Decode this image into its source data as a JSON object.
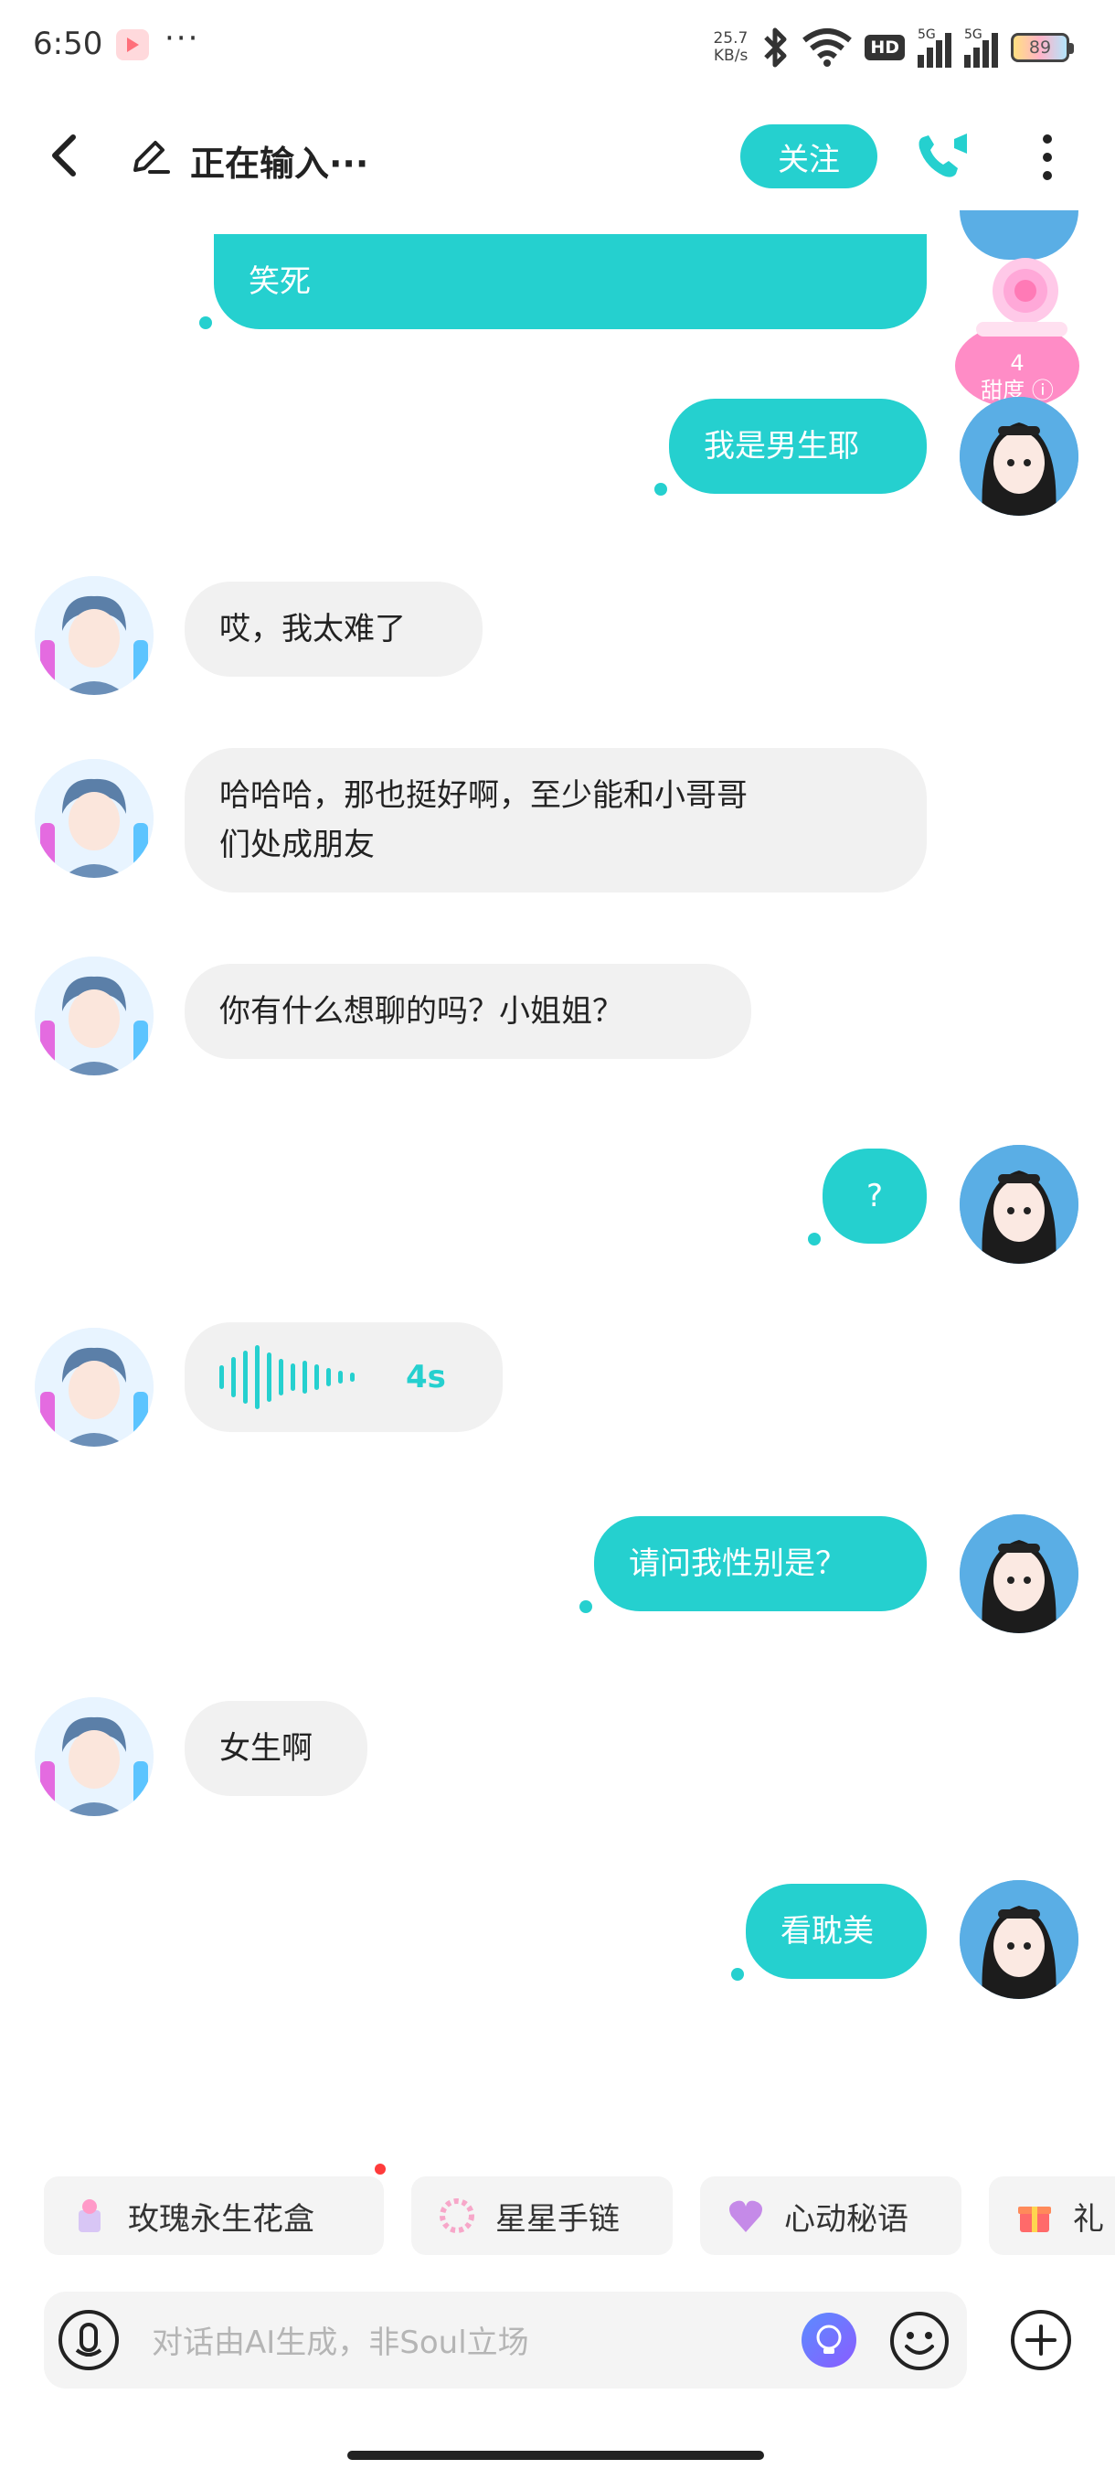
{
  "status_bar": {
    "time": "6:50",
    "dots": "···",
    "net_speed_value": "25.7",
    "net_speed_unit": "KB/s",
    "hd_label": "HD",
    "signal_label_1": "5G",
    "signal_label_2": "5G",
    "battery": "89"
  },
  "header": {
    "title": "正在输入···",
    "follow_label": "关注"
  },
  "sweetness": {
    "count": "4",
    "label": "甜度"
  },
  "messages": [
    {
      "side": "me",
      "text": "笑死"
    },
    {
      "side": "me",
      "text": "我是男生耶"
    },
    {
      "side": "them",
      "text": "哎，我太难了"
    },
    {
      "side": "them",
      "text": "哈哈哈，那也挺好啊，至少能和小哥哥\n们处成朋友"
    },
    {
      "side": "them",
      "text": "你有什么想聊的吗？小姐姐？"
    },
    {
      "side": "me",
      "text": "?"
    },
    {
      "side": "them",
      "type": "voice",
      "duration": "4s"
    },
    {
      "side": "me",
      "text": "请问我性别是？"
    },
    {
      "side": "them",
      "text": "女生啊"
    },
    {
      "side": "me",
      "text": "看耽美"
    }
  ],
  "chips": [
    {
      "label": "玫瑰永生花盒",
      "icon": "flower-box-icon"
    },
    {
      "label": "星星手链",
      "icon": "bracelet-icon"
    },
    {
      "label": "心动秘语",
      "icon": "heart-icon"
    },
    {
      "label": "礼",
      "icon": "gift-icon"
    }
  ],
  "input": {
    "placeholder": "对话由AI生成，非Soul立场"
  },
  "colors": {
    "accent": "#25d0cf",
    "bubble_other": "#f1f1f1",
    "badge_pink": "#ff7ab6"
  }
}
